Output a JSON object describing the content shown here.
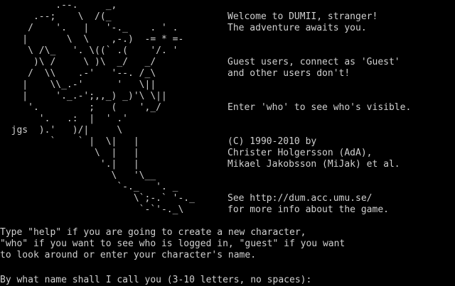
{
  "terminal": {
    "fg_color": "#d0d0d0",
    "bg_color": "#000000"
  },
  "ascii_art": {
    "signature": "jgs",
    "lines": [
      "          .--.     _,",
      "      .--;    \\  /(_",
      "     /    '.   |   '-._    . ' .",
      "    |       \\  \\    ,-.)  -= * =-",
      "     \\ /\\_   '. \\((` .(    '/. '",
      "      )\\ /     \\ )\\  _/   _/",
      "     /  \\\\    .-'   '--. /_\\",
      "    |    \\\\_.-'      '   \\||",
      "    |     '._.-';,,_) _)'\\ \\||",
      "     '.         ;   (    ',_/",
      "       '.   .:  |  ' .'",
      "  jgs  ).'   )/|     \\",
      "         `    ` |  \\|   |",
      "                 \\  |   |",
      "                  '.|   |",
      "                    \\   '\\__",
      "                     `-._   '. _",
      "                        \\`;-.` '-._",
      "                         `-`'-._\\"
    ]
  },
  "welcome": {
    "greeting_line1": "Welcome to DUMII, stranger!",
    "greeting_line2": "The adventure awaits you.",
    "guest_line1": "Guest users, connect as 'Guest'",
    "guest_line2": "and other users don't!",
    "who_line": "Enter 'who' to see who's visible.",
    "copyright_line1": "(C) 1990-2010 by",
    "copyright_line2": "Christer Holgersson (AdA),",
    "copyright_line3": "Mikael Jakobsson (MiJak) et al.",
    "info_line1": "See http://dum.acc.umu.se/",
    "info_line2": "for more info about the game."
  },
  "instructions": {
    "line1": "Type \"help\" if you are going to create a new character,",
    "line2": "\"who\" if you want to see who is logged in, \"guest\" if you want",
    "line3": "to look around or enter your character's name."
  },
  "prompt": {
    "text": "By what name shall I call you (3-10 letters, no spaces):"
  }
}
